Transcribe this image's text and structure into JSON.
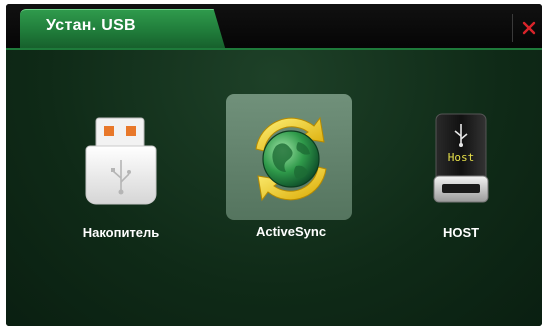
{
  "window": {
    "tab_title": "Устан. USB",
    "close_icon": "close-icon"
  },
  "items": [
    {
      "label": "Накопитель",
      "icon": "usb-drive-icon",
      "selected": false
    },
    {
      "label": "ActiveSync",
      "icon": "activesync-globe-icon",
      "selected": true
    },
    {
      "label": "HOST",
      "icon": "usb-host-icon",
      "selected": false,
      "icon_text": "Host"
    }
  ],
  "colors": {
    "accent": "#1f7a39",
    "background": "#0f2a17",
    "close": "#d9242a"
  }
}
